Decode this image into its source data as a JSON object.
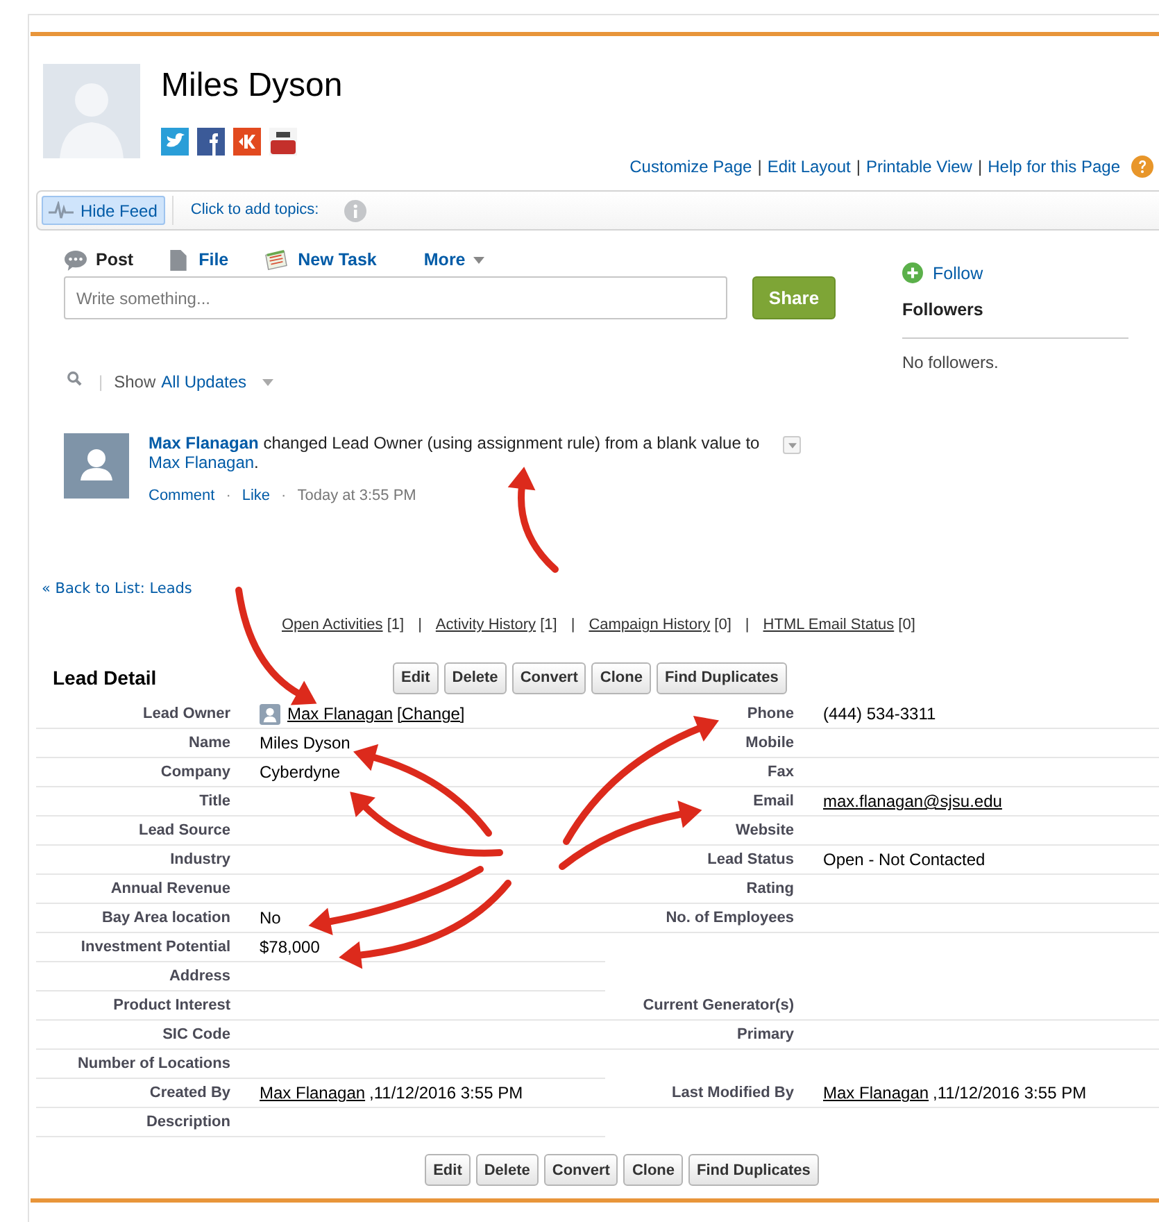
{
  "record": {
    "name": "Miles Dyson"
  },
  "page_links": {
    "separator": "|",
    "items": [
      "Customize Page",
      "Edit Layout",
      "Printable View",
      "Help for this Page"
    ]
  },
  "feed_bar": {
    "hide_feed": "Hide Feed",
    "topics": "Click to add topics:"
  },
  "publisher": {
    "actions": [
      {
        "label": "Post",
        "kind": "post",
        "selected": true
      },
      {
        "label": "File",
        "kind": "file",
        "selected": false
      },
      {
        "label": "New Task",
        "kind": "task",
        "selected": false
      },
      {
        "label": "More",
        "kind": "more",
        "selected": false
      }
    ],
    "placeholder": "Write something...",
    "share": "Share"
  },
  "followers": {
    "follow": "Follow",
    "title": "Followers",
    "empty": "No followers."
  },
  "filter": {
    "divider": "|",
    "show": "Show",
    "value": "All Updates"
  },
  "feed_item": {
    "actor": "Max Flanagan",
    "action": "changed Lead Owner (using assignment rule) from a blank value to",
    "target": "Max Flanagan",
    "end": ".",
    "comment": "Comment",
    "dot": "·",
    "like": "Like",
    "time": "Today at 3:55 PM"
  },
  "back_link": "« Back to List: Leads",
  "related_links": {
    "separator": "|",
    "items": [
      {
        "label": "Open Activities",
        "count": "[1]"
      },
      {
        "label": "Activity History",
        "count": "[1]"
      },
      {
        "label": "Campaign History",
        "count": "[0]"
      },
      {
        "label": "HTML Email Status",
        "count": "[0]"
      }
    ]
  },
  "detail": {
    "title": "Lead Detail",
    "buttons_top": [
      "Edit",
      "Delete",
      "Convert",
      "Clone",
      "Find Duplicates"
    ],
    "rows": [
      {
        "left": {
          "label": "Lead Owner",
          "value": {
            "kind": "owner",
            "link": "Max Flanagan",
            "action": "[Change]"
          }
        },
        "right": {
          "label": "Phone",
          "value": {
            "kind": "text",
            "text": "(444) 534-3311"
          }
        }
      },
      {
        "left": {
          "label": "Name",
          "value": {
            "kind": "text",
            "text": "Miles Dyson"
          }
        },
        "right": {
          "label": "Mobile"
        }
      },
      {
        "left": {
          "label": "Company",
          "value": {
            "kind": "text",
            "text": "Cyberdyne"
          }
        },
        "right": {
          "label": "Fax"
        }
      },
      {
        "left": {
          "label": "Title"
        },
        "right": {
          "label": "Email",
          "value": {
            "kind": "link",
            "link": "max.flanagan@sjsu.edu"
          }
        }
      },
      {
        "left": {
          "label": "Lead Source"
        },
        "right": {
          "label": "Website"
        }
      },
      {
        "left": {
          "label": "Industry"
        },
        "right": {
          "label": "Lead Status",
          "value": {
            "kind": "text",
            "text": "Open - Not Contacted"
          }
        }
      },
      {
        "left": {
          "label": "Annual Revenue"
        },
        "right": {
          "label": "Rating"
        }
      },
      {
        "left": {
          "label": "Bay Area location",
          "value": {
            "kind": "text",
            "text": "No"
          }
        },
        "right": {
          "label": "No. of Employees"
        }
      },
      {
        "left": {
          "label": "Investment Potential",
          "value": {
            "kind": "text",
            "text": "$78,000"
          }
        }
      },
      {
        "left": {
          "label": "Address"
        }
      },
      {
        "left": {
          "label": "Product Interest"
        },
        "right": {
          "label": "Current Generator(s)"
        }
      },
      {
        "left": {
          "label": "SIC Code"
        },
        "right": {
          "label": "Primary"
        }
      },
      {
        "left": {
          "label": "Number of Locations"
        }
      },
      {
        "left": {
          "label": "Created By",
          "value": {
            "kind": "link_text",
            "link": "Max Flanagan",
            "text": ",11/12/2016 3:55 PM"
          }
        },
        "right": {
          "label": "Last Modified By",
          "value": {
            "kind": "link_text",
            "link": "Max Flanagan",
            "text": ",11/12/2016 3:55 PM"
          }
        }
      },
      {
        "left": {
          "label": "Description"
        }
      }
    ],
    "buttons_bottom": [
      "Edit",
      "Delete",
      "Convert",
      "Clone",
      "Find Duplicates"
    ]
  }
}
